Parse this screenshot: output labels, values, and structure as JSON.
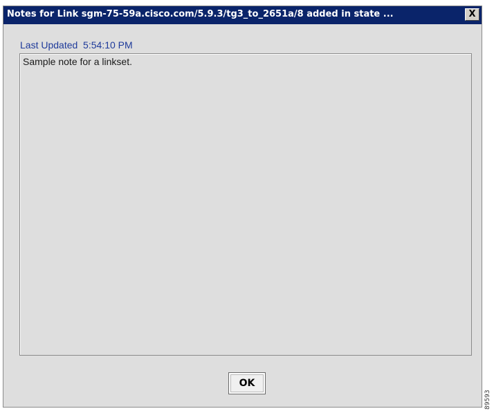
{
  "window": {
    "title": "Notes for Link sgm-75-59a.cisco.com/5.9.3/tg3_to_2651a/8 added in state ...",
    "close_label": "X"
  },
  "notes": {
    "last_updated_label": "Last Updated  5:54:10 PM",
    "text": "Sample note for a linkset."
  },
  "buttons": {
    "ok_label": "OK"
  },
  "figure_id": "89593",
  "colors": {
    "titlebar": "#0a246a",
    "label_blue": "#1e3a9a",
    "panel_bg": "#dedede"
  }
}
